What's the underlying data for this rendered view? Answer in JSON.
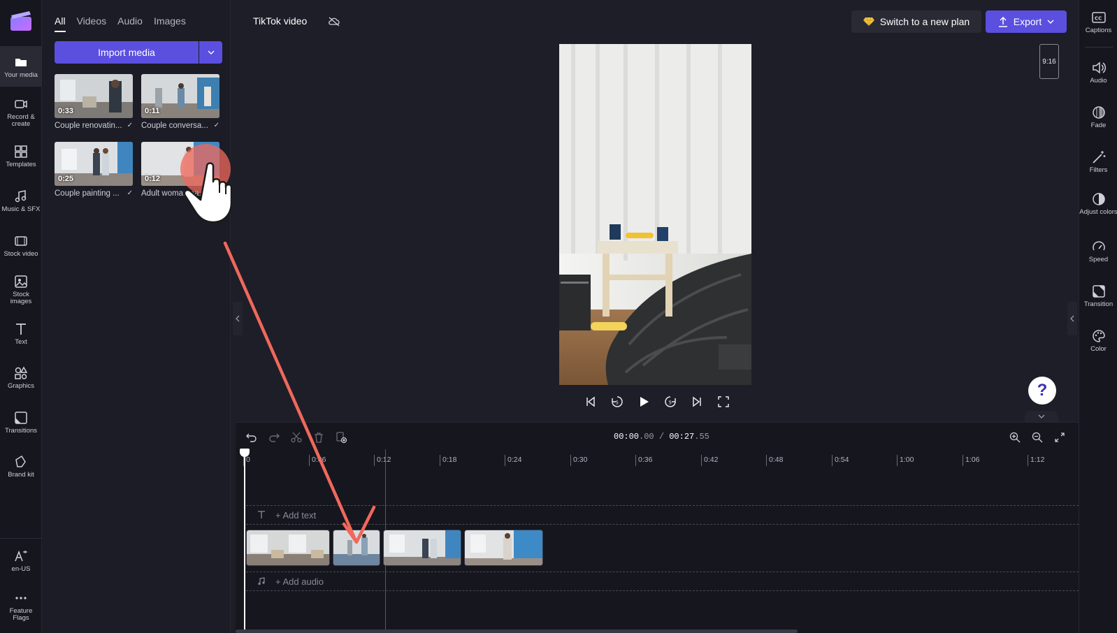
{
  "app": {
    "project_title": "TikTok video",
    "switch_plan_label": "Switch to a new plan",
    "export_label": "Export"
  },
  "leftnav": {
    "items": [
      {
        "label": "Your media",
        "icon": "folder-icon"
      },
      {
        "label": "Record & create",
        "icon": "camera-icon"
      },
      {
        "label": "Templates",
        "icon": "templates-icon"
      },
      {
        "label": "Music & SFX",
        "icon": "music-icon"
      },
      {
        "label": "Stock video",
        "icon": "film-icon"
      },
      {
        "label": "Stock images",
        "icon": "image-icon"
      },
      {
        "label": "Text",
        "icon": "text-icon"
      },
      {
        "label": "Graphics",
        "icon": "shapes-icon"
      },
      {
        "label": "Transitions",
        "icon": "transition-icon"
      },
      {
        "label": "Brand kit",
        "icon": "brand-icon"
      },
      {
        "label": "en-US",
        "icon": "language-icon"
      },
      {
        "label": "Feature Flags",
        "icon": "more-icon"
      }
    ]
  },
  "media": {
    "tabs": [
      "All",
      "Videos",
      "Audio",
      "Images"
    ],
    "import_label": "Import media",
    "items": [
      {
        "duration": "0:33",
        "name": "Couple renovatin..."
      },
      {
        "duration": "0:11",
        "name": "Couple conversa..."
      },
      {
        "duration": "0:25",
        "name": "Couple painting ..."
      },
      {
        "duration": "0:12",
        "name": "Adult woman pa..."
      }
    ]
  },
  "preview": {
    "aspect_ratio": "9:16"
  },
  "rightnav": {
    "items": [
      {
        "label": "Captions",
        "icon": "captions-icon"
      },
      {
        "label": "Audio",
        "icon": "speaker-icon"
      },
      {
        "label": "Fade",
        "icon": "fade-icon"
      },
      {
        "label": "Filters",
        "icon": "wand-icon"
      },
      {
        "label": "Adjust colors",
        "icon": "contrast-icon"
      },
      {
        "label": "Speed",
        "icon": "speedometer-icon"
      },
      {
        "label": "Transition",
        "icon": "transition-icon"
      },
      {
        "label": "Color",
        "icon": "palette-icon"
      }
    ]
  },
  "help": {
    "label": "?"
  },
  "timeline": {
    "current_time": "00:00",
    "current_frac": ".00",
    "separator": " / ",
    "total_time": "00:27",
    "total_frac": ".55",
    "ticks": [
      "0",
      "0:06",
      "0:12",
      "0:18",
      "0:24",
      "0:30",
      "0:36",
      "0:42",
      "0:48",
      "0:54",
      "1:00",
      "1:06",
      "1:12"
    ],
    "add_text_label": "+ Add text",
    "add_audio_label": "+ Add audio"
  }
}
